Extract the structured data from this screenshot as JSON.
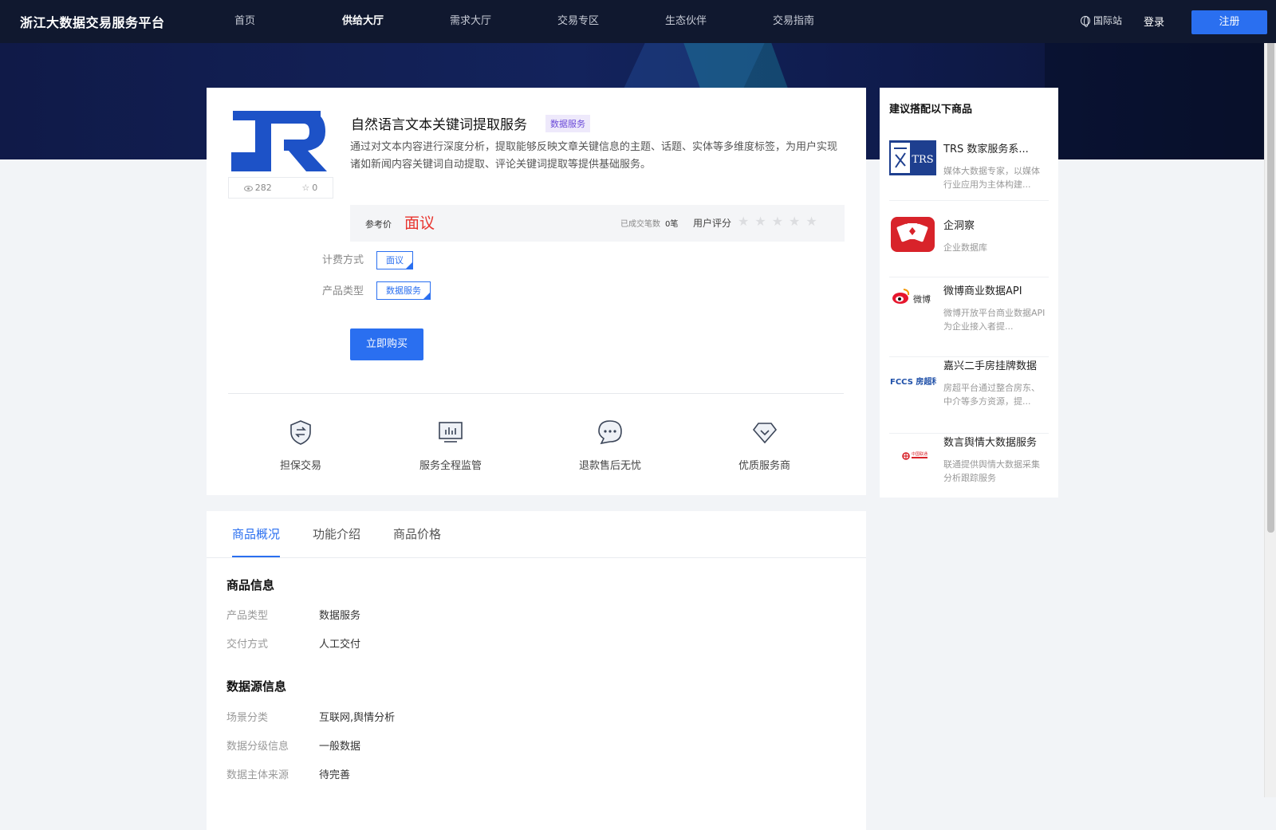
{
  "header": {
    "logo": "浙江大数据交易服务平台",
    "nav": [
      "首页",
      "供给大厅",
      "需求大厅",
      "交易专区",
      "生态伙伴",
      "交易指南"
    ],
    "active_nav": "供给大厅",
    "intl": "国际站",
    "login": "登录",
    "register": "注册"
  },
  "product": {
    "logo_letter": "R",
    "views": "282",
    "favorites": "0",
    "title": "自然语言文本关键词提取服务",
    "tag": "数据服务",
    "description": "通过对文本内容进行深度分析，提取能够反映文章关键信息的主题、话题、实体等多维度标签，为用户实现诸如新闻内容关键词自动提取、评论关键词提取等提供基础服务。",
    "price_label": "参考价",
    "price": "面议",
    "deal_label": "已成交笔数",
    "deal_count": "0笔",
    "rating_label": "用户评分",
    "rating_stars": "★★★★★",
    "billing_label": "计费方式",
    "billing_value": "面议",
    "type_label": "产品类型",
    "type_value": "数据服务",
    "buy_button": "立即购买"
  },
  "guarantees": [
    "担保交易",
    "服务全程监管",
    "退款售后无忧",
    "优质服务商"
  ],
  "tabs": [
    "商品概况",
    "功能介绍",
    "商品价格"
  ],
  "sections": {
    "goods_title": "商品信息",
    "goods": [
      {
        "label": "产品类型",
        "value": "数据服务"
      },
      {
        "label": "交付方式",
        "value": "人工交付"
      }
    ],
    "source_title": "数据源信息",
    "source": [
      {
        "label": "场景分类",
        "value": "互联网,舆情分析"
      },
      {
        "label": "数据分级信息",
        "value": "一般数据"
      },
      {
        "label": "数据主体来源",
        "value": "待完善"
      }
    ]
  },
  "sidebar": {
    "title": "建议搭配以下商品",
    "items": [
      {
        "name": "TRS 数家服务系...",
        "desc": "媒体大数据专家，以媒体行业应用为主体构建...",
        "thumb_text": "TRS"
      },
      {
        "name": "企洞察",
        "desc": "企业数据库",
        "thumb_text": ""
      },
      {
        "name": "微博商业数据API",
        "desc": "微博开放平台商业数据API为企业接入者提...",
        "thumb_text": "微博"
      },
      {
        "name": "嘉兴二手房挂牌数据",
        "desc": "房超平台通过整合房东、中介等多方资源，提...",
        "thumb_text": "FCCS 房超科技"
      },
      {
        "name": "数言舆情大数据服务",
        "desc": "联通提供舆情大数据采集分析跟踪服务",
        "thumb_text": "中国联通"
      }
    ]
  },
  "colors": {
    "accent": "#2a6ff0",
    "price_red": "#e8342e",
    "header_bg": "#10182f"
  }
}
